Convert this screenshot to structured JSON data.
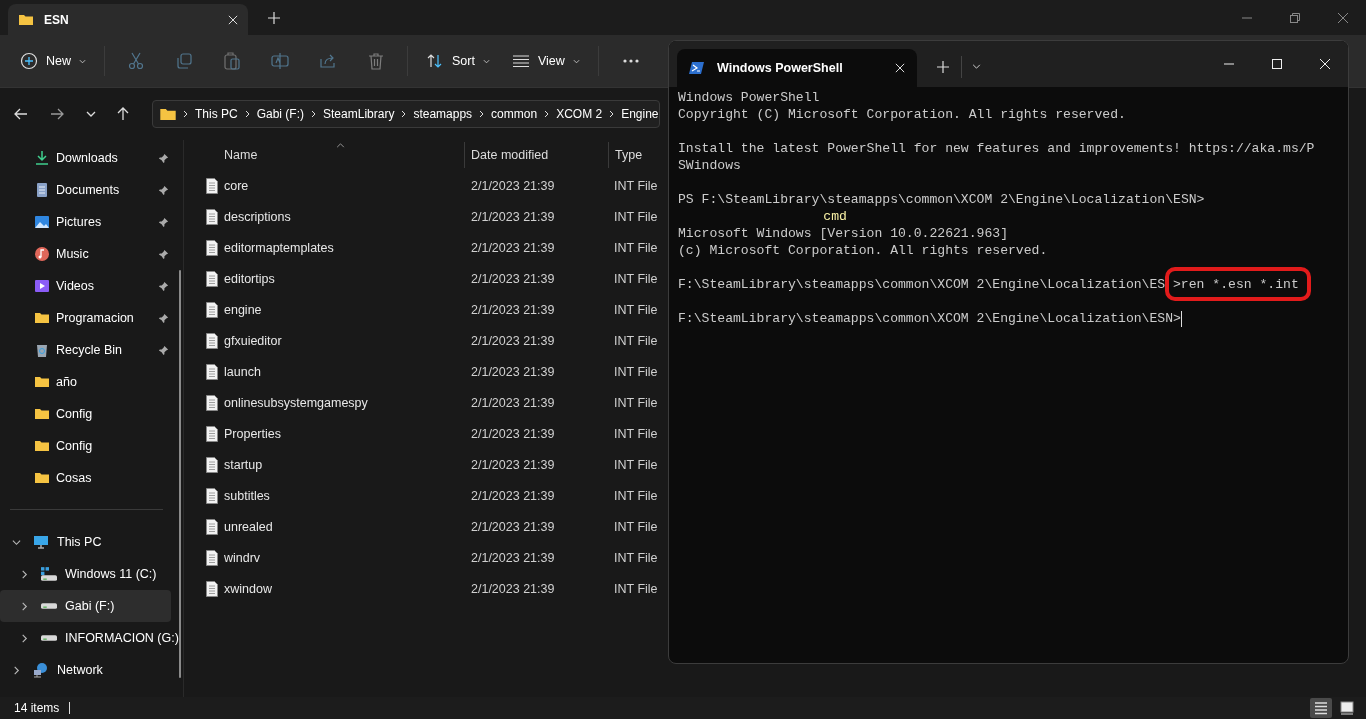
{
  "explorer": {
    "tab": {
      "title": "ESN"
    },
    "toolbar": {
      "new": {
        "label": "New"
      },
      "actions": [
        {
          "disabled": true
        },
        {
          "disabled": true
        },
        {
          "disabled": true
        },
        {
          "disabled": true
        },
        {
          "disabled": true
        },
        {
          "disabled": true
        }
      ],
      "sort": {
        "label": "Sort"
      },
      "view": {
        "label": "View"
      }
    },
    "breadcrumb": [
      "This PC",
      "Gabi (F:)",
      "SteamLibrary",
      "steamapps",
      "common",
      "XCOM 2",
      "Engine"
    ],
    "quick_access": [
      {
        "label": "Downloads",
        "kind": "downloads",
        "pinned": true
      },
      {
        "label": "Documents",
        "kind": "documents",
        "pinned": true
      },
      {
        "label": "Pictures",
        "kind": "pictures",
        "pinned": true
      },
      {
        "label": "Music",
        "kind": "music",
        "pinned": true
      },
      {
        "label": "Videos",
        "kind": "videos",
        "pinned": true
      },
      {
        "label": "Programacion",
        "kind": "folder",
        "pinned": true
      },
      {
        "label": "Recycle Bin",
        "kind": "recycle",
        "pinned": true
      },
      {
        "label": "año",
        "kind": "folder",
        "pinned": false
      },
      {
        "label": "Config",
        "kind": "folder",
        "pinned": false
      },
      {
        "label": "Config",
        "kind": "folder",
        "pinned": false
      },
      {
        "label": "Cosas",
        "kind": "folder",
        "pinned": false
      }
    ],
    "tree": [
      {
        "label": "This PC",
        "kind": "pc",
        "expanded": true,
        "selected": false,
        "children": [
          {
            "label": "Windows 11 (C:)",
            "kind": "system-drive",
            "expanded": false,
            "selected": false
          },
          {
            "label": "Gabi (F:)",
            "kind": "drive",
            "expanded": false,
            "selected": true
          },
          {
            "label": "INFORMACION (G:)",
            "kind": "drive",
            "expanded": false,
            "selected": false
          }
        ]
      },
      {
        "label": "Network",
        "kind": "network",
        "expanded": false,
        "selected": false
      }
    ],
    "columns": [
      "Name",
      "Date modified",
      "Type"
    ],
    "files": [
      {
        "name": "core",
        "date": "2/1/2023 21:39",
        "type": "INT File"
      },
      {
        "name": "descriptions",
        "date": "2/1/2023 21:39",
        "type": "INT File"
      },
      {
        "name": "editormaptemplates",
        "date": "2/1/2023 21:39",
        "type": "INT File"
      },
      {
        "name": "editortips",
        "date": "2/1/2023 21:39",
        "type": "INT File"
      },
      {
        "name": "engine",
        "date": "2/1/2023 21:39",
        "type": "INT File"
      },
      {
        "name": "gfxuieditor",
        "date": "2/1/2023 21:39",
        "type": "INT File"
      },
      {
        "name": "launch",
        "date": "2/1/2023 21:39",
        "type": "INT File"
      },
      {
        "name": "onlinesubsystemgamespy",
        "date": "2/1/2023 21:39",
        "type": "INT File"
      },
      {
        "name": "Properties",
        "date": "2/1/2023 21:39",
        "type": "INT File"
      },
      {
        "name": "startup",
        "date": "2/1/2023 21:39",
        "type": "INT File"
      },
      {
        "name": "subtitles",
        "date": "2/1/2023 21:39",
        "type": "INT File"
      },
      {
        "name": "unrealed",
        "date": "2/1/2023 21:39",
        "type": "INT File"
      },
      {
        "name": "windrv",
        "date": "2/1/2023 21:39",
        "type": "INT File"
      },
      {
        "name": "xwindow",
        "date": "2/1/2023 21:39",
        "type": "INT File"
      }
    ],
    "status": {
      "count": "14 items",
      "views": [
        {
          "kind": "details",
          "selected": true
        },
        {
          "kind": "tiles",
          "selected": false
        }
      ]
    }
  },
  "terminal": {
    "tab": {
      "title": "Windows PowerShell"
    },
    "blocks": [
      [
        {
          "kind": "plain",
          "text": "Windows PowerShell"
        },
        {
          "kind": "plain",
          "text": "Copyright (C) Microsoft Corporation. All rights reserved."
        }
      ],
      [
        {
          "kind": "plain",
          "text": "Install the latest PowerShell for new features and improvements! https://aka.ms/P"
        },
        {
          "kind": "plain",
          "text": "SWindows"
        }
      ],
      [
        {
          "kind": "plain",
          "text": "PS F:\\SteamLibrary\\steamapps\\common\\XCOM 2\\Engine\\Localization\\ESN>"
        },
        {
          "kind": "typed",
          "text": "cmd"
        },
        {
          "kind": "plain",
          "text": "Microsoft Windows [Version 10.0.22621.963]"
        },
        {
          "kind": "plain",
          "text": "(c) Microsoft Corporation. All rights reserved."
        }
      ],
      [
        {
          "kind": "command",
          "prompt": "F:\\SteamLibrary\\steamapps\\common\\XCOM 2\\Engine\\Localization\\ES",
          "command": ">ren *.esn *.int",
          "circled": true
        }
      ],
      [
        {
          "kind": "prompt",
          "text": "F:\\SteamLibrary\\steamapps\\common\\XCOM 2\\Engine\\Localization\\ESN>",
          "cursor": true
        }
      ]
    ]
  }
}
